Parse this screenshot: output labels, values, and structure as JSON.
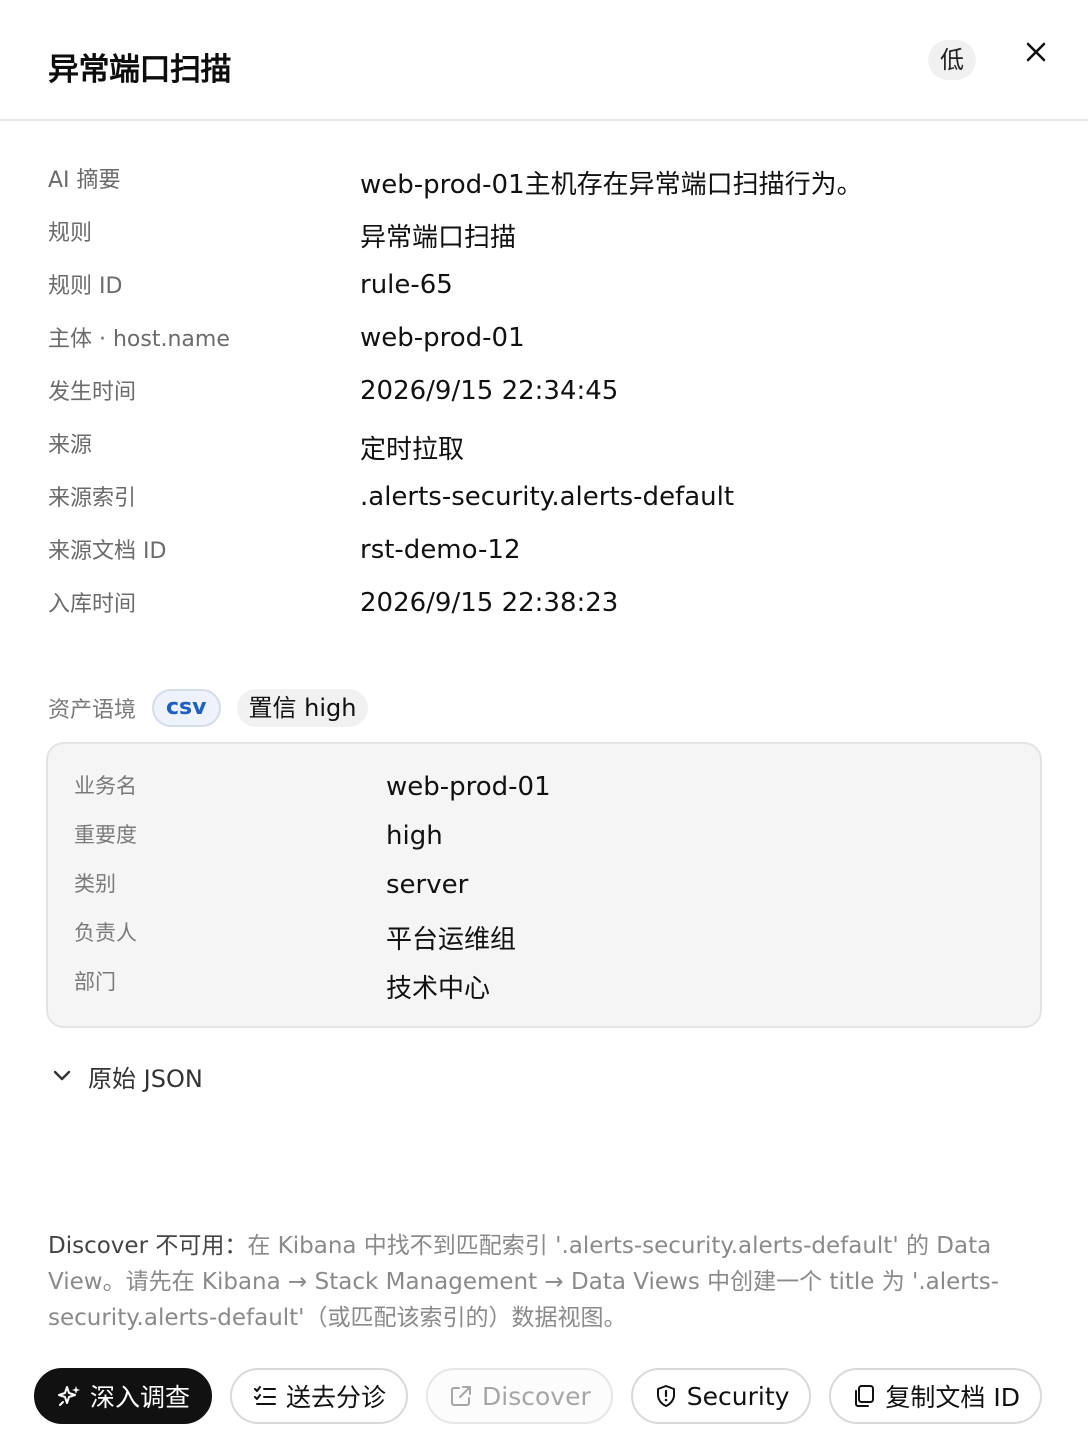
{
  "header": {
    "title": "异常端口扫描",
    "severity": "低"
  },
  "details": [
    {
      "label": "AI 摘要",
      "value": "web-prod-01主机存在异常端口扫描行为。"
    },
    {
      "label": "规则",
      "value": "异常端口扫描"
    },
    {
      "label": "规则 ID",
      "value": "rule-65"
    },
    {
      "label": "主体 · host.name",
      "value": "web-prod-01"
    },
    {
      "label": "发生时间",
      "value": "2026/9/15 22:34:45"
    },
    {
      "label": "来源",
      "value": "定时拉取"
    },
    {
      "label": "来源索引",
      "value": ".alerts-security.alerts-default"
    },
    {
      "label": "来源文档 ID",
      "value": "rst-demo-12"
    },
    {
      "label": "入库时间",
      "value": "2026/9/15 22:38:23"
    }
  ],
  "asset": {
    "label": "资产语境",
    "source_badge": "csv",
    "confidence_badge": "置信 high",
    "rows": [
      {
        "label": "业务名",
        "value": "web-prod-01"
      },
      {
        "label": "重要度",
        "value": "high"
      },
      {
        "label": "类别",
        "value": "server"
      },
      {
        "label": "负责人",
        "value": "平台运维组"
      },
      {
        "label": "部门",
        "value": "技术中心"
      }
    ]
  },
  "raw_json": {
    "label": "原始 JSON"
  },
  "notice": {
    "head": "Discover 不可用：",
    "body": "在 Kibana 中找不到匹配索引 '.alerts-security.alerts-default' 的 Data View。请先在 Kibana → Stack Management → Data Views 中创建一个 title 为 '.alerts-security.alerts-default'（或匹配该索引的）数据视图。"
  },
  "actions": {
    "investigate": "深入调查",
    "triage": "送去分诊",
    "discover": "Discover",
    "security": "Security",
    "copy_doc_id": "复制文档 ID"
  },
  "colors": {
    "primary_button": "#111111",
    "csv_badge_text": "#1f5fbf",
    "muted_text": "#8a8a8a"
  },
  "icons": {
    "close": "close-icon",
    "chevron": "chevron-down-icon",
    "investigate": "sparkle-icon",
    "triage": "checklist-icon",
    "discover": "external-link-icon",
    "security": "shield-alert-icon",
    "copy": "copy-icon"
  }
}
